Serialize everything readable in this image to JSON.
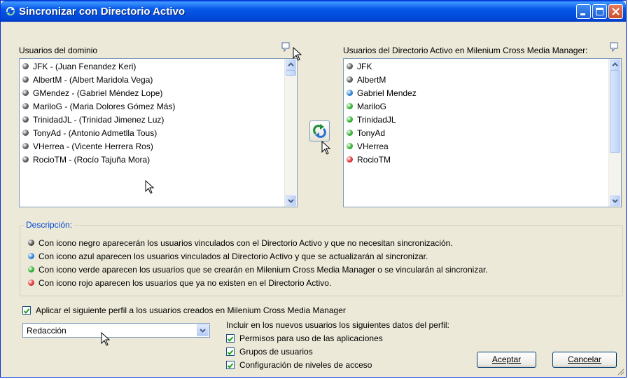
{
  "window": {
    "title": "Sincronizar con Directorio Activo"
  },
  "left_list": {
    "label": "Usuarios del dominio",
    "items": [
      {
        "text": "JFK - (Juan Fenandez Keri)",
        "color": "#5a5a5a"
      },
      {
        "text": "AlbertM - (Albert Maridola Vega)",
        "color": "#5a5a5a"
      },
      {
        "text": "GMendez - (Gabriel Méndez Lope)",
        "color": "#5a5a5a"
      },
      {
        "text": "MariloG - (Maria Dolores Gómez Más)",
        "color": "#5a5a5a"
      },
      {
        "text": "TrinidadJL - (Trinidad Jimenez Luz)",
        "color": "#5a5a5a"
      },
      {
        "text": "TonyAd - (Antonio Admetlla Tous)",
        "color": "#5a5a5a"
      },
      {
        "text": "VHerrea - (Vicente Herrera Ros)",
        "color": "#5a5a5a"
      },
      {
        "text": "RocioTM - (Rocío Tajuña Mora)",
        "color": "#5a5a5a"
      }
    ]
  },
  "right_list": {
    "label": "Usuarios del Directorio Activo en Milenium Cross Media Manager:",
    "items": [
      {
        "text": "JFK",
        "color": "#5a5a5a"
      },
      {
        "text": "AlbertM",
        "color": "#5a5a5a"
      },
      {
        "text": "Gabriel Mendez",
        "color": "#2a7fd4"
      },
      {
        "text": "MariloG",
        "color": "#2eae2e"
      },
      {
        "text": "TrinidadJL",
        "color": "#2eae2e"
      },
      {
        "text": "TonyAd",
        "color": "#2eae2e"
      },
      {
        "text": "VHerrea",
        "color": "#2eae2e"
      },
      {
        "text": "RocioTM",
        "color": "#e03030"
      }
    ]
  },
  "description": {
    "legend": "Descripción:",
    "lines": [
      {
        "text": "Con icono negro aparecerán los usuarios vinculados con el Directorio Activo y que no necesitan sincronización.",
        "color": "#4a4a4a"
      },
      {
        "text": "Con icono azul aparecen los usuarios vinculados al Directorio Activo y que se actualizarán al sincronizar.",
        "color": "#2a7fd4"
      },
      {
        "text": "Con icono verde aparecen los usuarios que se crearán en Milenium Cross Media Manager o se vincularán al sincronizar.",
        "color": "#2eae2e"
      },
      {
        "text": "Con icono rojo aparecen los usuarios que ya no existen en el Directorio Activo.",
        "color": "#e03030"
      }
    ]
  },
  "profile": {
    "apply_label": "Aplicar el siguiente perfil a los usuarios creados en Milenium Cross Media Manager",
    "apply_checked": true,
    "selected_profile": "Redacción",
    "include_label": "Incluir en los nuevos usuarios los siguientes datos del perfil:",
    "options": [
      {
        "label": "Permisos para uso de las aplicaciones",
        "checked": true
      },
      {
        "label": "Grupos de usuarios",
        "checked": true
      },
      {
        "label": "Configuración de niveles de acceso",
        "checked": true
      }
    ]
  },
  "buttons": {
    "accept": "Aceptar",
    "cancel": "Cancelar"
  },
  "icons": {
    "app": "sync-app-icon",
    "sync": "sync-arrows-icon",
    "refresh": "refresh-list-icon"
  }
}
